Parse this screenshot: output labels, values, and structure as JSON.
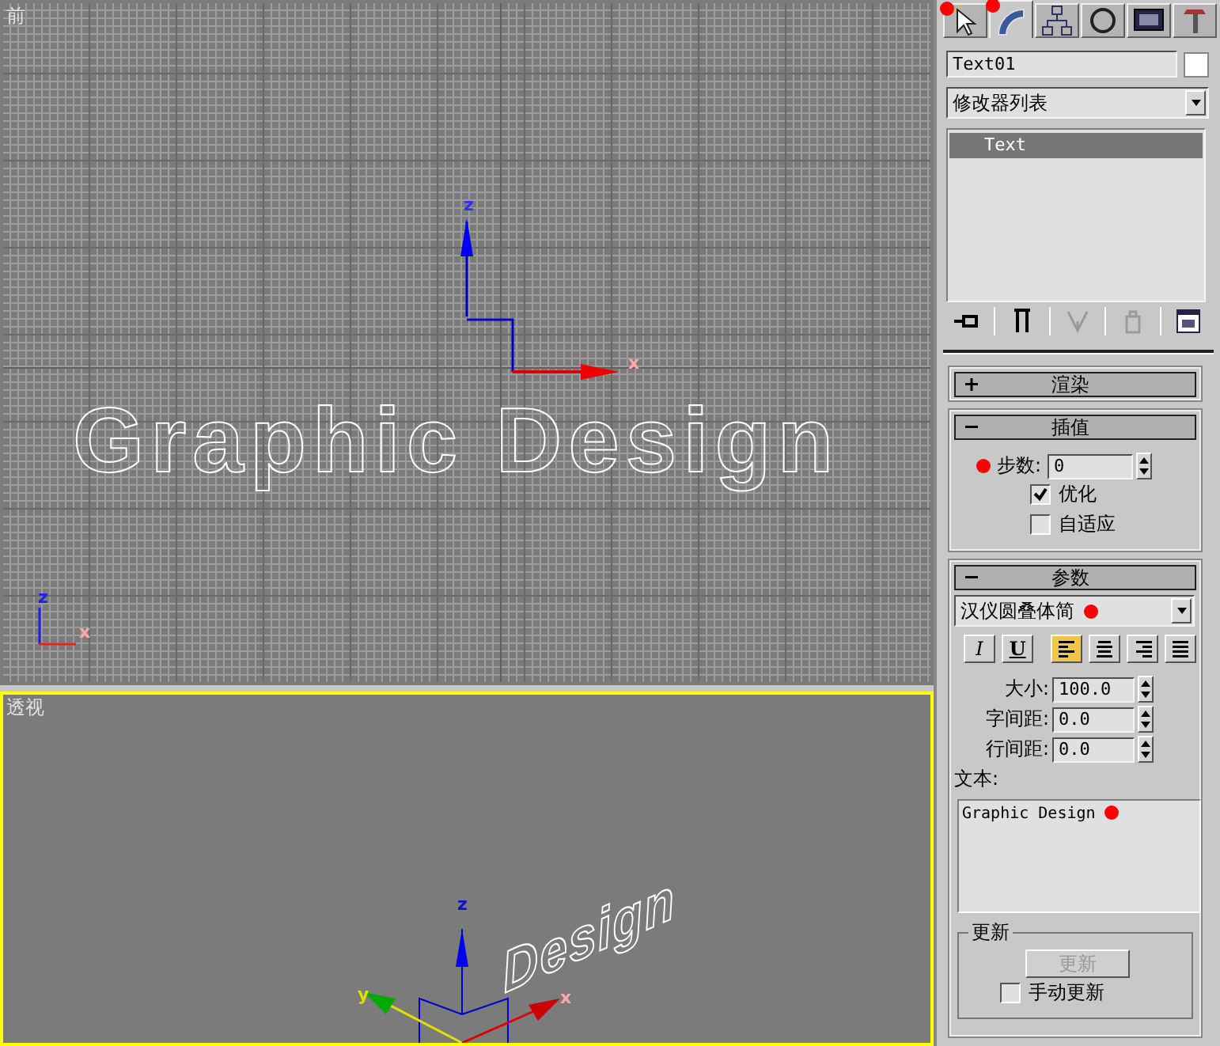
{
  "viewports": [
    {
      "kind": "orthographic",
      "label": "前",
      "active": false,
      "object_text": "Graphic Design",
      "gizmo_labels": {
        "z": "z",
        "x": "x"
      },
      "corner_labels": {
        "z": "z",
        "x": "x"
      }
    },
    {
      "kind": "perspective",
      "label": "透视",
      "active": true,
      "object_text": "Design",
      "gizmo_labels": {
        "z": "z",
        "y": "y",
        "x": "x"
      }
    }
  ],
  "panel": {
    "tabs": [
      {
        "kind": "create",
        "selected": false,
        "annotated": true
      },
      {
        "kind": "modify",
        "selected": true,
        "annotated": true
      },
      {
        "kind": "hierarchy",
        "selected": false,
        "annotated": false
      },
      {
        "kind": "motion",
        "selected": false,
        "annotated": false
      },
      {
        "kind": "display",
        "selected": false,
        "annotated": false
      },
      {
        "kind": "utilities",
        "selected": false,
        "annotated": false
      }
    ],
    "object_name": "Text01",
    "modifier_list": "修改器列表",
    "stack": [
      {
        "label": "Text",
        "selected": true
      }
    ],
    "stack_tools": [
      {
        "kind": "pin",
        "disabled": false
      },
      {
        "kind": "pipe",
        "disabled": false
      },
      {
        "kind": "fork",
        "disabled": true
      },
      {
        "kind": "bin",
        "disabled": true
      },
      {
        "kind": "configure",
        "disabled": false
      }
    ],
    "rollouts": [
      {
        "title": "渲染",
        "expanded": false
      },
      {
        "kind": "interpolation",
        "title": "插值",
        "expanded": true,
        "steps": {
          "label": "步数:",
          "value": "0",
          "annotated": true
        },
        "options": [
          {
            "label": "优化",
            "checked": true
          },
          {
            "label": "自适应",
            "checked": false
          }
        ]
      },
      {
        "kind": "parameters",
        "title": "参数",
        "expanded": true,
        "font": {
          "value": "汉仪圆叠体简",
          "annotated": true
        },
        "styles": [
          {
            "label": "I",
            "kind": "italic",
            "selected": false
          },
          {
            "label": "U",
            "kind": "underline",
            "selected": false
          }
        ],
        "alignments": [
          {
            "kind": "left",
            "selected": true
          },
          {
            "kind": "center",
            "selected": false
          },
          {
            "kind": "right",
            "selected": false
          },
          {
            "kind": "justify",
            "selected": false
          }
        ],
        "fields": [
          {
            "label": "大小:",
            "value": "100.0"
          },
          {
            "label": "字间距:",
            "value": "0.0"
          },
          {
            "label": "行间距:",
            "value": "0.0"
          }
        ],
        "text_label": "文本:",
        "text": {
          "value": "Graphic Design",
          "annotated": true
        },
        "update": {
          "title": "更新",
          "button": "更新",
          "button_disabled": true,
          "manual": {
            "label": "手动更新",
            "checked": false
          }
        }
      }
    ]
  }
}
